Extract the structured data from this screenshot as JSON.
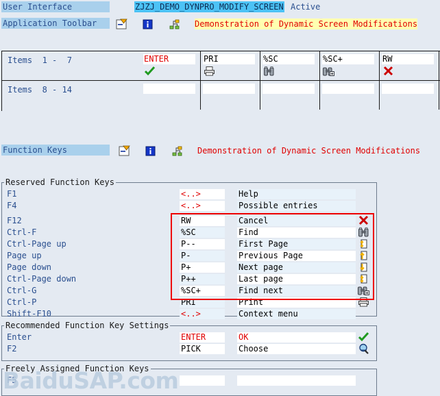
{
  "colors": {
    "background": "#e4eaf2",
    "label_highlight": "#a9d0ec",
    "selected_cyan": "#4cc2f5",
    "title_yellow": "#ffffb0",
    "title_red": "#e00000",
    "field_blue": "#2a4f8f",
    "red_box": "#ee0000",
    "groupbox_border": "#6d7b8d"
  },
  "user_interface": {
    "label": "User Interface",
    "name": "ZJZJ_DEMO_DYNPRO_MODIFY_SCREEN",
    "status": "Active"
  },
  "application_toolbar": {
    "label": "Application Toolbar",
    "title": "Demonstration of Dynamic Screen Modifications",
    "icons": [
      "list-detail-icon",
      "info-icon",
      "hierarchy-icon"
    ]
  },
  "function_keys_header": {
    "label": "Function Keys",
    "title": "Demonstration of Dynamic Screen Modifications",
    "icons": [
      "list-detail-icon",
      "info-icon",
      "hierarchy-icon"
    ]
  },
  "items_table": {
    "rows": [
      {
        "label": "Items  1 -  7",
        "cells": [
          {
            "code": "ENTER",
            "code_color": "#e00000",
            "icon": "green-check-icon"
          },
          {
            "code": "PRI",
            "code_color": "#1a1a1a",
            "icon": "print-icon"
          },
          {
            "code": "%SC",
            "code_color": "#1a1a1a",
            "icon": "binoculars-icon"
          },
          {
            "code": "%SC+",
            "code_color": "#1a1a1a",
            "icon": "binoculars-plus-icon"
          },
          {
            "code": "RW",
            "code_color": "#1a1a1a",
            "icon": "red-x-icon"
          },
          {
            "code": "",
            "code_color": "#1a1a1a",
            "icon": ""
          },
          {
            "code": "",
            "code_color": "#1a1a1a",
            "icon": ""
          }
        ]
      },
      {
        "label": "Items  8 - 14",
        "cells": [
          {
            "code": "",
            "code_color": "#1a1a1a",
            "icon": ""
          },
          {
            "code": "",
            "code_color": "#1a1a1a",
            "icon": ""
          },
          {
            "code": "",
            "code_color": "#1a1a1a",
            "icon": ""
          },
          {
            "code": "",
            "code_color": "#1a1a1a",
            "icon": ""
          },
          {
            "code": "",
            "code_color": "#1a1a1a",
            "icon": ""
          },
          {
            "code": "",
            "code_color": "#1a1a1a",
            "icon": ""
          },
          {
            "code": "",
            "code_color": "#1a1a1a",
            "icon": ""
          }
        ]
      }
    ]
  },
  "reserved_function_keys": {
    "title": "Reserved Function Keys",
    "rows": [
      {
        "key": "F1",
        "code": "<..>",
        "code_color": "#e00000",
        "text": "Help",
        "icon": ""
      },
      {
        "key": "F4",
        "code": "<..>",
        "code_color": "#e00000",
        "text": "Possible entries",
        "icon": ""
      },
      {
        "key": "F12",
        "code": "RW",
        "code_color": "#1a1a1a",
        "text": "Cancel",
        "icon": "red-x-icon"
      },
      {
        "key": "Ctrl-F",
        "code": "%SC",
        "code_color": "#1a1a1a",
        "text": "Find",
        "icon": "binoculars-icon"
      },
      {
        "key": "Ctrl-Page up",
        "code": "P--",
        "code_color": "#1a1a1a",
        "text": "First Page",
        "icon": "first-page-icon"
      },
      {
        "key": "Page up",
        "code": "P-",
        "code_color": "#1a1a1a",
        "text": "Previous Page",
        "icon": "previous-page-icon"
      },
      {
        "key": "Page down",
        "code": "P+",
        "code_color": "#1a1a1a",
        "text": "Next page",
        "icon": "next-page-icon"
      },
      {
        "key": "Ctrl-Page down",
        "code": "P++",
        "code_color": "#1a1a1a",
        "text": "Last page",
        "icon": "last-page-icon"
      },
      {
        "key": "Ctrl-G",
        "code": "%SC+",
        "code_color": "#1a1a1a",
        "text": "Find next",
        "icon": "binoculars-plus-icon"
      },
      {
        "key": "Ctrl-P",
        "code": "PRI",
        "code_color": "#1a1a1a",
        "text": "Print",
        "icon": "print-icon"
      },
      {
        "key": "Shift-F10",
        "code": "<..>",
        "code_color": "#e00000",
        "text": "Context menu",
        "icon": ""
      }
    ]
  },
  "recommended_function_keys": {
    "title": "Recommended Function Key Settings",
    "rows": [
      {
        "key": "Enter",
        "code": "ENTER",
        "code_color": "#e00000",
        "text": "OK",
        "text_color": "#e00000",
        "icon": "green-check-icon"
      },
      {
        "key": "F2",
        "code": "PICK",
        "code_color": "#1a1a1a",
        "text": "Choose",
        "text_color": "#1a1a1a",
        "icon": "magnifier-icon"
      }
    ]
  },
  "freely_assigned_function_keys": {
    "title": "Freely Assigned Function Keys",
    "rows": [
      {
        "key": "F5",
        "code": "",
        "code_color": "#1a1a1a",
        "text": "",
        "icon": ""
      }
    ]
  },
  "watermark": {
    "text": "BaiduSAP.com"
  }
}
